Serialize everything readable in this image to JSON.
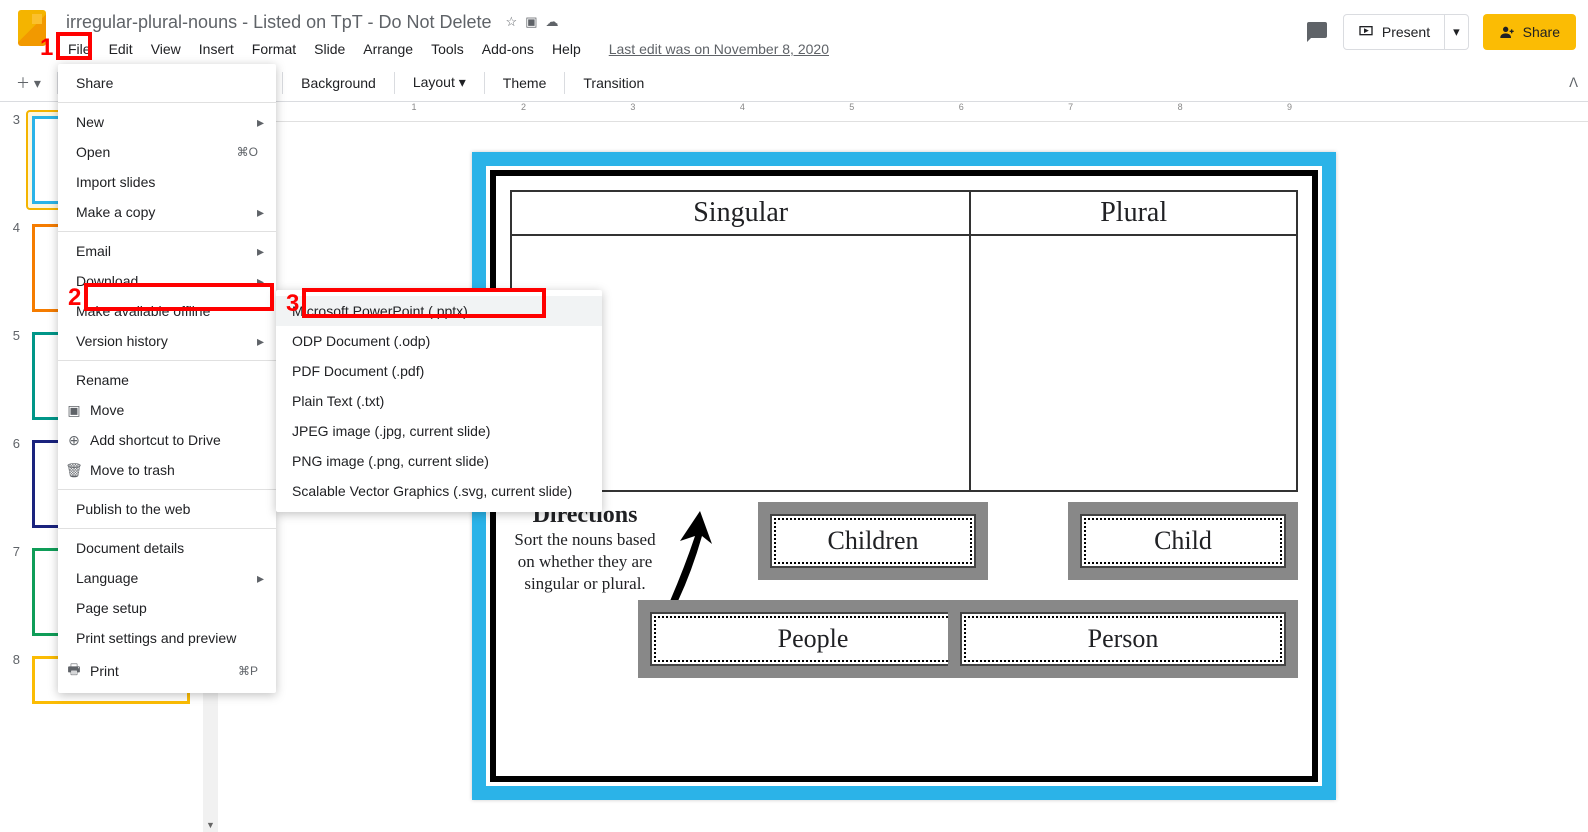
{
  "doc": {
    "title": "irregular-plural-nouns - Listed on TpT - Do Not Delete",
    "last_edit": "Last edit was on November 8, 2020"
  },
  "menubar": {
    "file": "File",
    "edit": "Edit",
    "view": "View",
    "insert": "Insert",
    "format": "Format",
    "slide": "Slide",
    "arrange": "Arrange",
    "tools": "Tools",
    "addons": "Add-ons",
    "help": "Help"
  },
  "header_actions": {
    "present": "Present",
    "share": "Share"
  },
  "toolbar": {
    "background": "Background",
    "layout": "Layout",
    "theme": "Theme",
    "transition": "Transition"
  },
  "file_menu": {
    "share": "Share",
    "new": "New",
    "open": "Open",
    "open_shortcut": "⌘O",
    "import_slides": "Import slides",
    "make_a_copy": "Make a copy",
    "email": "Email",
    "download": "Download",
    "make_available_offline": "Make available offline",
    "version_history": "Version history",
    "rename": "Rename",
    "move": "Move",
    "add_shortcut": "Add shortcut to Drive",
    "move_to_trash": "Move to trash",
    "publish": "Publish to the web",
    "doc_details": "Document details",
    "language": "Language",
    "page_setup": "Page setup",
    "print_settings": "Print settings and preview",
    "print": "Print",
    "print_shortcut": "⌘P"
  },
  "download_submenu": {
    "pptx": "Microsoft PowerPoint (.pptx)",
    "odp": "ODP Document (.odp)",
    "pdf": "PDF Document (.pdf)",
    "txt": "Plain Text (.txt)",
    "jpg": "JPEG image (.jpg, current slide)",
    "png": "PNG image (.png, current slide)",
    "svg": "Scalable Vector Graphics (.svg, current slide)"
  },
  "thumbs": {
    "n3": "3",
    "n4": "4",
    "n5": "5",
    "n6": "6",
    "n7": "7",
    "n8": "8"
  },
  "slide": {
    "singular": "Singular",
    "plural": "Plural",
    "dir_title": "Directions",
    "dir_body": "Sort the nouns based on whether they are singular or plural.",
    "card_children": "Children",
    "card_child": "Child",
    "card_people": "People",
    "card_person": "Person"
  },
  "annotations": {
    "n1": "1",
    "n2": "2",
    "n3": "3"
  },
  "ruler": {
    "r1": "1",
    "r2": "2",
    "r3": "3",
    "r4": "4",
    "r5": "5",
    "r6": "6",
    "r7": "7",
    "r8": "8",
    "r9": "9"
  }
}
